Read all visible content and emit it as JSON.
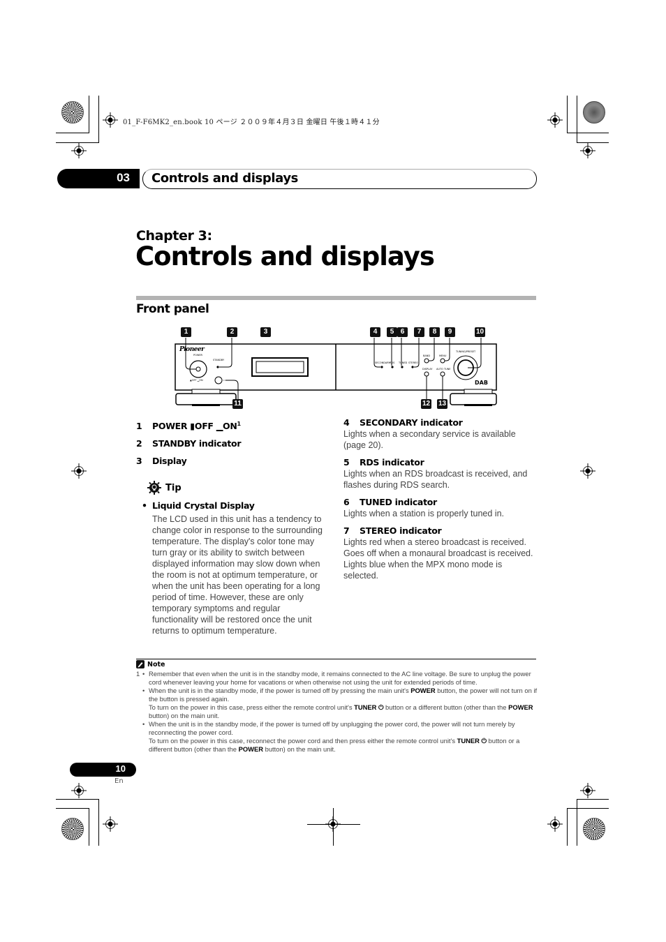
{
  "print_header": "01_F-F6MK2_en.book  10 ページ  ２００９年４月３日  金曜日  午後１時４１分",
  "chapter_tab": {
    "number": "03",
    "title": "Controls and displays"
  },
  "chapter_label": "Chapter 3:",
  "chapter_title": "Controls and displays",
  "section_title": "Front panel",
  "diagram": {
    "brand": "Pioneer",
    "labels": {
      "power": "POWER",
      "standby": "STANDBY",
      "off_on": "▲OFF ▁ON",
      "secondary": "SECONDARY",
      "rds": "RDS",
      "tuned": "TUNED",
      "stereo": "STEREO",
      "band": "BAND",
      "menu": "MENU",
      "display": "DISPLAY",
      "auto_tune": "AUTO TUNE",
      "tuning_preset": "TUNING/PRESET",
      "dab": "DAB"
    },
    "callouts": [
      "1",
      "2",
      "3",
      "4",
      "5",
      "6",
      "7",
      "8",
      "9",
      "10",
      "11",
      "12",
      "13"
    ]
  },
  "items_left": [
    {
      "num": "1",
      "label": "POWER ▮OFF ▁ON",
      "sup": "1"
    },
    {
      "num": "2",
      "label": "STANDBY indicator"
    },
    {
      "num": "3",
      "label": "Display"
    }
  ],
  "tip": {
    "heading": "Tip",
    "bullet_title": "Liquid Crystal Display",
    "bullet_text": "The LCD used in this unit has a tendency to change color in response to the surrounding temperature. The display's color tone may turn gray or its ability to switch between displayed information may slow down when the room is not at optimum temperature, or when the unit has been operating for a long period of time. However, these are only temporary symptoms and regular functionality will be restored once the unit returns to optimum temperature."
  },
  "items_right": [
    {
      "num": "4",
      "label": "SECONDARY indicator",
      "desc": "Lights when a secondary service is available (page 20)."
    },
    {
      "num": "5",
      "label": "RDS indicator",
      "desc": "Lights when an RDS broadcast is received, and flashes during RDS search."
    },
    {
      "num": "6",
      "label": "TUNED indicator",
      "desc": "Lights when a station is properly tuned in."
    },
    {
      "num": "7",
      "label": "STEREO indicator",
      "desc": "Lights red when a stereo broadcast is received. Goes off when a monaural broadcast is received. Lights blue when the MPX mono mode is selected."
    }
  ],
  "note": {
    "heading": "Note",
    "footnote_num": "1",
    "bullets": [
      {
        "parts": [
          "Remember that even when the unit is in the standby mode, it remains connected to the AC line voltage. Be sure to unplug the power cord whenever leaving your home for vacations or when otherwise not using the unit for extended periods of time."
        ]
      },
      {
        "parts": [
          "When the unit is in the standby mode, if the power is turned off by pressing the main unit's ",
          "POWER",
          " button, the power will not turn on if the button is pressed again."
        ]
      },
      {
        "continuation": true,
        "parts": [
          "To turn on the power in this case, press either the remote control unit's ",
          "TUNER ⏻",
          " button or a different button (other than the ",
          "POWER",
          " button) on the main unit."
        ]
      },
      {
        "parts": [
          "When the unit is in the standby mode, if the power is turned off by unplugging the power cord, the power will not turn merely by reconnecting the power cord."
        ]
      },
      {
        "continuation": true,
        "parts": [
          "To turn on the power in this case, reconnect the power cord and then press either the remote control unit's ",
          "TUNER ⏻",
          " button or a different button (other than the ",
          "POWER",
          " button) on the main unit."
        ]
      }
    ]
  },
  "page": {
    "number": "10",
    "lang": "En"
  }
}
